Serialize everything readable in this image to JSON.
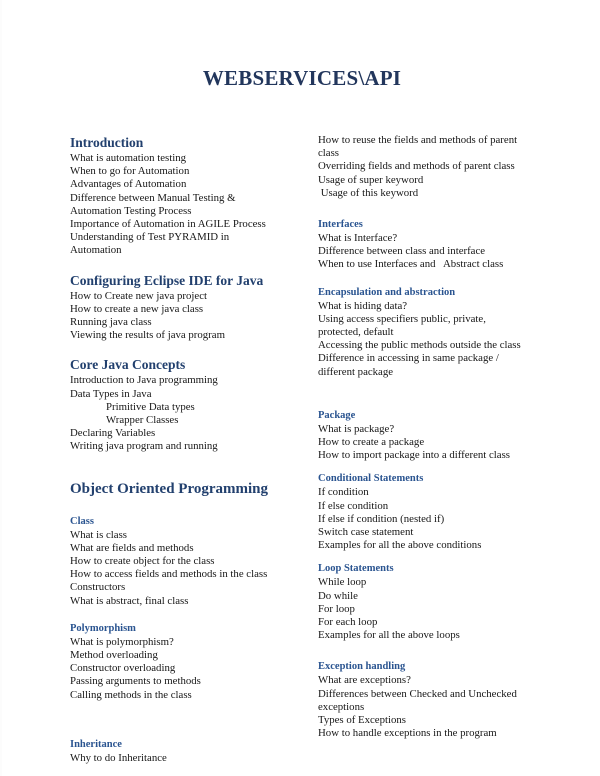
{
  "document": {
    "title": "WEBSERVICES\\API"
  },
  "left_column": {
    "sections": [
      {
        "heading": "Introduction",
        "heading_level": "major",
        "items": [
          "What is automation testing",
          "When to go for Automation",
          "Advantages of Automation",
          "Difference between Manual Testing &",
          "Automation Testing Process",
          "Importance of Automation in AGILE Process",
          "Understanding of Test PYRAMID in",
          "Automation"
        ]
      },
      {
        "heading": "Configuring Eclipse IDE for Java",
        "heading_level": "major",
        "items": [
          "How to Create new java project",
          "How to create a new java class",
          "Running java class",
          "Viewing the results of java program"
        ]
      },
      {
        "heading": "Core Java Concepts",
        "heading_level": "major",
        "items": [
          "Introduction to Java programming",
          "Data Types in Java",
          "Primitive Data types",
          "Wrapper Classes",
          "Declaring Variables",
          "Writing java program and running"
        ],
        "indented_items": [
          2,
          3
        ]
      },
      {
        "heading": "Object Oriented Programming",
        "heading_level": "big",
        "items": []
      },
      {
        "heading": "Class",
        "heading_level": "sub",
        "items": [
          "What is class",
          "What are fields and methods",
          "How to create object for the class",
          "How to access fields and methods in the class",
          "Constructors",
          "What is abstract, final class"
        ]
      },
      {
        "heading": "Polymorphism",
        "heading_level": "sub",
        "items": [
          "What is polymorphism?",
          "Method overloading",
          "Constructor overloading",
          "Passing arguments to methods",
          "Calling methods in the class"
        ]
      },
      {
        "heading": "Inheritance",
        "heading_level": "sub",
        "items": [
          "Why to do Inheritance"
        ]
      }
    ]
  },
  "right_column": {
    "sections": [
      {
        "heading": "",
        "heading_level": "none",
        "items": [
          "How to reuse the fields and methods of parent",
          "class",
          "Overriding fields and methods of parent class",
          "Usage of super keyword",
          " Usage of this keyword"
        ]
      },
      {
        "heading": "Interfaces",
        "heading_level": "sub",
        "items": [
          "What is Interface?",
          "Difference between class and interface",
          "When to use Interfaces and   Abstract class"
        ]
      },
      {
        "heading": "Encapsulation and abstraction",
        "heading_level": "sub",
        "items": [
          "What is hiding data?",
          "Using access specifiers public, private,",
          "protected, default",
          "Accessing the public methods outside the class",
          "Difference in accessing in same package /",
          "different package"
        ]
      },
      {
        "heading": "Package",
        "heading_level": "sub",
        "items": [
          "What is package?",
          "How to create a package",
          "How to import package into a different class"
        ]
      },
      {
        "heading": "Conditional Statements",
        "heading_level": "sub",
        "items": [
          "If condition",
          "If else condition",
          "If else if condition (nested if)",
          "Switch case statement",
          "Examples for all the above conditions"
        ]
      },
      {
        "heading": "Loop Statements",
        "heading_level": "sub",
        "items": [
          "While loop",
          "Do while",
          "For loop",
          "For each loop",
          "Examples for all the above loops"
        ]
      },
      {
        "heading": "Exception handling",
        "heading_level": "sub",
        "items": [
          "What are exceptions?",
          "Differences between Checked and Unchecked",
          "exceptions",
          "Types of Exceptions",
          "How to handle exceptions in the program"
        ]
      }
    ]
  },
  "colors": {
    "title": "#22365c",
    "major_heading": "#22406e",
    "sub_heading": "#2a5490",
    "body_text": "#171717",
    "page_background": "#ffffff"
  }
}
